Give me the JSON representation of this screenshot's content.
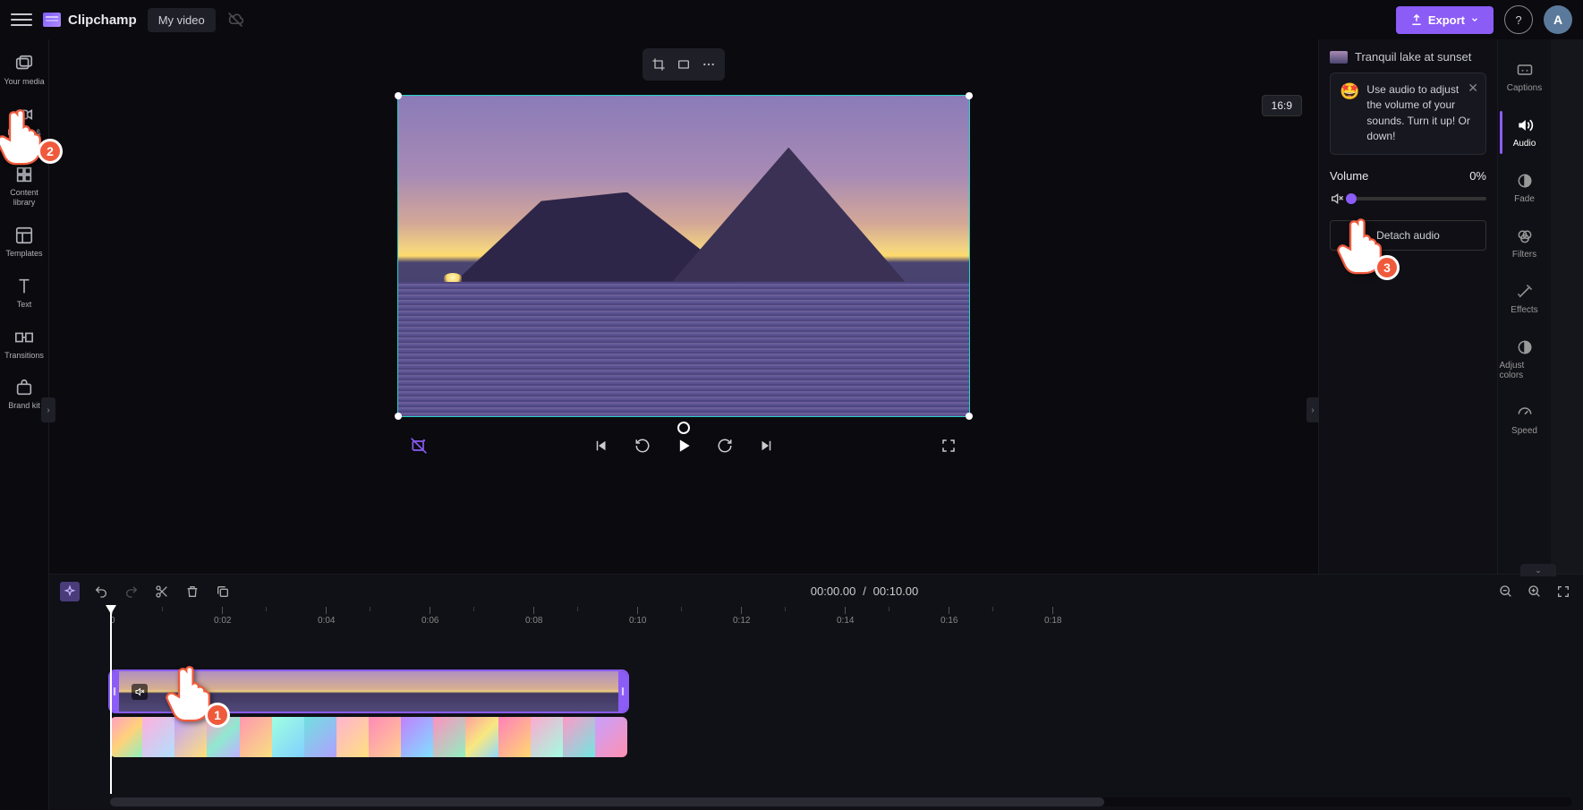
{
  "app": {
    "brand": "Clipchamp",
    "title": "My video"
  },
  "header": {
    "export_label": "Export",
    "avatar_initial": "A"
  },
  "leftnav": {
    "items": [
      {
        "label": "Your media"
      },
      {
        "label": "Record & create"
      },
      {
        "label": "Content library"
      },
      {
        "label": "Templates"
      },
      {
        "label": "Text"
      },
      {
        "label": "Transitions"
      },
      {
        "label": "Brand kit"
      }
    ]
  },
  "preview": {
    "aspect_label": "16:9"
  },
  "playback": {
    "current_time": "00:00.00",
    "separator": "/",
    "total_time": "00:10.00"
  },
  "prop_panel": {
    "clip_name": "Tranquil lake at sunset",
    "tip_emoji": "🤩",
    "tip_text": "Use audio to adjust the volume of your sounds. Turn it up! Or down!",
    "volume_label": "Volume",
    "volume_value": "0%",
    "detach_label": "Detach audio"
  },
  "rightnav": {
    "items": [
      {
        "label": "Captions"
      },
      {
        "label": "Audio"
      },
      {
        "label": "Fade"
      },
      {
        "label": "Filters"
      },
      {
        "label": "Effects"
      },
      {
        "label": "Adjust colors"
      },
      {
        "label": "Speed"
      }
    ],
    "active_index": 1
  },
  "timeline": {
    "ticks": [
      "0",
      "0:02",
      "0:04",
      "0:06",
      "0:08",
      "0:10",
      "0:12",
      "0:14",
      "0:16",
      "0:18"
    ],
    "tick_spacing_px": 116
  },
  "annotations": {
    "p1": "1",
    "p2": "2",
    "p3": "3"
  }
}
